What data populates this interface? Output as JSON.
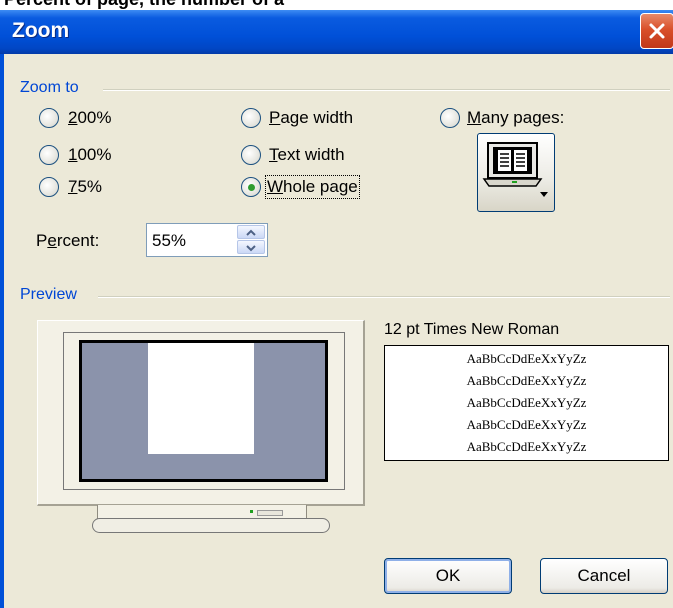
{
  "header_strip": "Percent of page, the number of a",
  "window": {
    "title": "Zoom"
  },
  "zoom_to": {
    "label": "Zoom to",
    "options": [
      {
        "pre": "",
        "key": "2",
        "post": "00%",
        "checked": false
      },
      {
        "pre": "",
        "key": "1",
        "post": "00%",
        "checked": false
      },
      {
        "pre": "",
        "key": "7",
        "post": "5%",
        "checked": false
      },
      {
        "pre": "",
        "key": "P",
        "post": "age width",
        "checked": false
      },
      {
        "pre": "",
        "key": "T",
        "post": "ext width",
        "checked": false
      },
      {
        "pre": "",
        "key": "W",
        "post": "hole page",
        "checked": true
      },
      {
        "pre": "",
        "key": "M",
        "post": "any pages:",
        "checked": false
      }
    ]
  },
  "percent": {
    "pre": "P",
    "key": "e",
    "post": "rcent:",
    "value": "55%"
  },
  "preview": {
    "label": "Preview",
    "font_name": "12 pt Times New Roman",
    "sample_lines": [
      "AaBbCcDdEeXxYyZz",
      "AaBbCcDdEeXxYyZz",
      "AaBbCcDdEeXxYyZz",
      "AaBbCcDdEeXxYyZz",
      "AaBbCcDdEeXxYyZz"
    ]
  },
  "buttons": {
    "ok": "OK",
    "cancel": "Cancel"
  },
  "icons": {
    "close": "close-icon",
    "many_pages": "many-pages-icon",
    "spin_up": "spin-up-icon",
    "spin_down": "spin-down-icon"
  },
  "colors": {
    "titlebar": "#0050d8",
    "dialog_bg": "#ece9d8",
    "group_label": "#0046d5",
    "preview_screen": "#8b93ab",
    "radio_dot": "#2f9c2f"
  }
}
